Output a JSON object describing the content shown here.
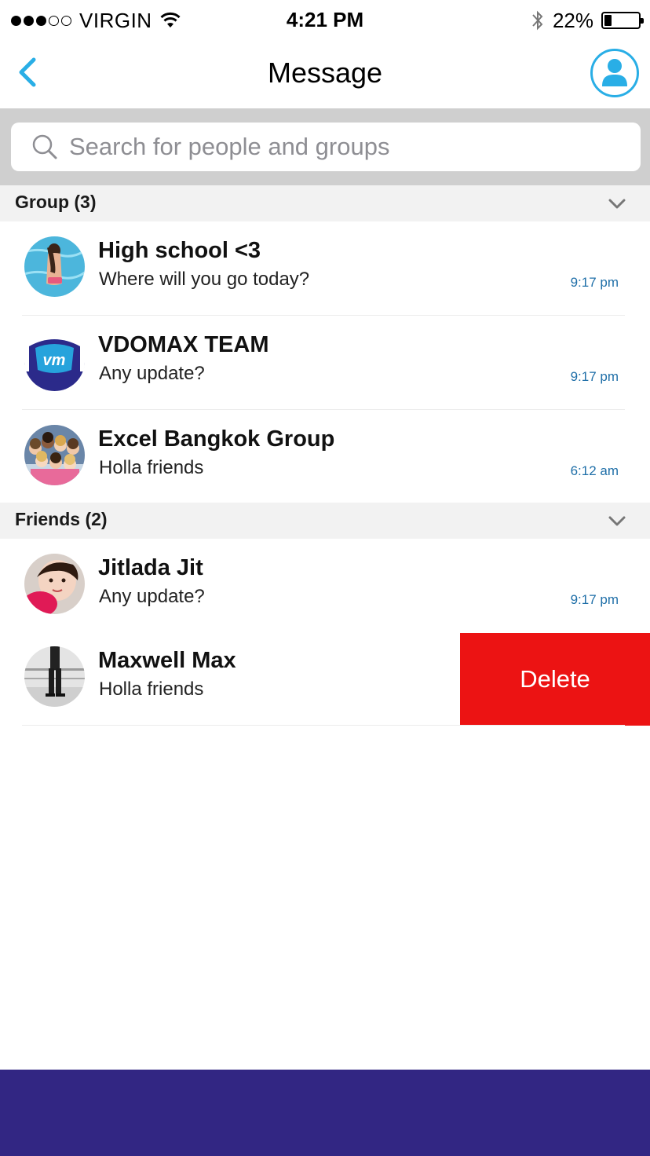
{
  "status_bar": {
    "carrier": "VIRGIN",
    "time": "4:21 PM",
    "battery_percent": "22%",
    "battery_level": 0.22,
    "signal_bars_filled": 3,
    "signal_bars_total": 5
  },
  "nav": {
    "title": "Message",
    "back_icon": "chevron-left-icon",
    "profile_icon": "user-icon"
  },
  "search": {
    "placeholder": "Search for people and groups",
    "value": ""
  },
  "sections": [
    {
      "title": "Group (3)",
      "items": [
        {
          "name": "High school <3",
          "message": "Where will you go today?",
          "time": "9:17 pm",
          "avatar": "pool-photo"
        },
        {
          "name": "VDOMAX TEAM",
          "message": "Any update?",
          "time": "9:17 pm",
          "avatar": "vdomax-logo"
        },
        {
          "name": "Excel Bangkok Group",
          "message": "Holla friends",
          "time": "6:12 am",
          "avatar": "group-photo"
        }
      ]
    },
    {
      "title": "Friends (2)",
      "items": [
        {
          "name": "Jitlada Jit",
          "message": "Any update?",
          "time": "9:17 pm",
          "avatar": "girl-photo"
        },
        {
          "name": "Maxwell Max",
          "message": "Holla friends",
          "time": "",
          "avatar": "person-photo",
          "action": "Delete"
        }
      ]
    }
  ],
  "logo_text": "vm",
  "colors": {
    "accent": "#29aee6",
    "delete": "#ec1313",
    "bottom_bar": "#322683",
    "time_text": "#1f6fa8"
  }
}
